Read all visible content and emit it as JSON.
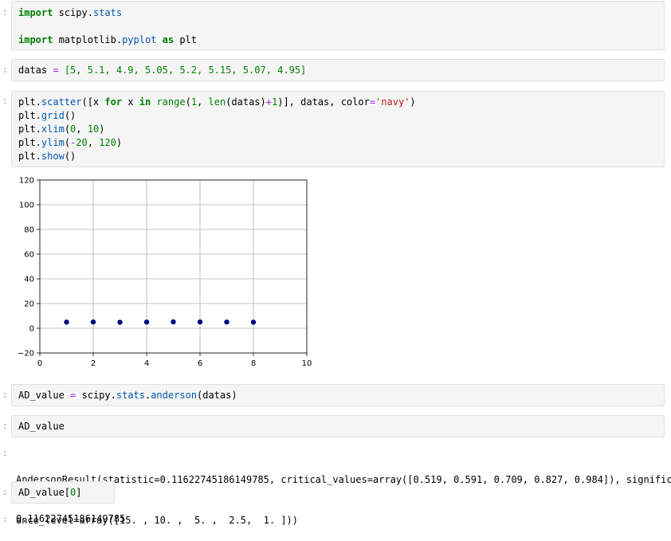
{
  "cells": [
    {
      "kind": "code",
      "lines": [
        [
          {
            "t": "kw",
            "v": "import"
          },
          {
            "t": "nm",
            "v": " scipy."
          },
          {
            "t": "fn",
            "v": "stats"
          }
        ],
        [],
        [
          {
            "t": "kw",
            "v": "import"
          },
          {
            "t": "nm",
            "v": " matplotlib."
          },
          {
            "t": "fn",
            "v": "pyplot"
          },
          {
            "t": "nm",
            "v": " "
          },
          {
            "t": "kw",
            "v": "as"
          },
          {
            "t": "nm",
            "v": " plt"
          }
        ]
      ]
    },
    {
      "kind": "code",
      "lines": [
        [
          {
            "t": "nm",
            "v": "datas "
          },
          {
            "t": "op",
            "v": "="
          },
          {
            "t": "nm",
            "v": " "
          },
          {
            "t": "num",
            "v": "[5, 5.1, 4.9, 5.05, 5.2, 5.15, 5.07, 4.95]"
          }
        ]
      ]
    },
    {
      "kind": "code",
      "lines": [
        [
          {
            "t": "nm",
            "v": "plt."
          },
          {
            "t": "fn",
            "v": "scatter"
          },
          {
            "t": "nm",
            "v": "([x "
          },
          {
            "t": "kw",
            "v": "for"
          },
          {
            "t": "nm",
            "v": " x "
          },
          {
            "t": "kw",
            "v": "in"
          },
          {
            "t": "nm",
            "v": " "
          },
          {
            "t": "num",
            "v": "range"
          },
          {
            "t": "nm",
            "v": "("
          },
          {
            "t": "num",
            "v": "1"
          },
          {
            "t": "nm",
            "v": ", "
          },
          {
            "t": "num",
            "v": "len"
          },
          {
            "t": "nm",
            "v": "(datas)"
          },
          {
            "t": "op",
            "v": "+"
          },
          {
            "t": "num",
            "v": "1"
          },
          {
            "t": "nm",
            "v": ")], datas, color"
          },
          {
            "t": "op",
            "v": "="
          },
          {
            "t": "str",
            "v": "'navy'"
          },
          {
            "t": "nm",
            "v": ")"
          }
        ],
        [
          {
            "t": "nm",
            "v": "plt."
          },
          {
            "t": "fn",
            "v": "grid"
          },
          {
            "t": "nm",
            "v": "()"
          }
        ],
        [
          {
            "t": "nm",
            "v": "plt."
          },
          {
            "t": "fn",
            "v": "xlim"
          },
          {
            "t": "nm",
            "v": "("
          },
          {
            "t": "num",
            "v": "0"
          },
          {
            "t": "nm",
            "v": ", "
          },
          {
            "t": "num",
            "v": "10"
          },
          {
            "t": "nm",
            "v": ")"
          }
        ],
        [
          {
            "t": "nm",
            "v": "plt."
          },
          {
            "t": "fn",
            "v": "ylim"
          },
          {
            "t": "nm",
            "v": "("
          },
          {
            "t": "op",
            "v": "-"
          },
          {
            "t": "num",
            "v": "20"
          },
          {
            "t": "nm",
            "v": ", "
          },
          {
            "t": "num",
            "v": "120"
          },
          {
            "t": "nm",
            "v": ")"
          }
        ],
        [
          {
            "t": "nm",
            "v": "plt."
          },
          {
            "t": "fn",
            "v": "show"
          },
          {
            "t": "nm",
            "v": "()"
          }
        ]
      ]
    },
    {
      "kind": "code",
      "lines": [
        [
          {
            "t": "nm",
            "v": "AD_value "
          },
          {
            "t": "op",
            "v": "="
          },
          {
            "t": "nm",
            "v": " scipy."
          },
          {
            "t": "fn",
            "v": "stats"
          },
          {
            "t": "nm",
            "v": "."
          },
          {
            "t": "fn",
            "v": "anderson"
          },
          {
            "t": "nm",
            "v": "(datas)"
          }
        ]
      ]
    },
    {
      "kind": "code",
      "lines": [
        [
          {
            "t": "nm",
            "v": "AD_value"
          }
        ]
      ]
    },
    {
      "kind": "code",
      "lines": [
        [
          {
            "t": "nm",
            "v": "AD_value["
          },
          {
            "t": "num",
            "v": "0"
          },
          {
            "t": "nm",
            "v": "]"
          }
        ]
      ]
    }
  ],
  "outputs": {
    "anderson_result": [
      "AndersonResult(statistic=0.11622745186149785, critical_values=array([0.519, 0.591, 0.709, 0.827, 0.984]), signific",
      "ance_level=array([15. , 10. ,  5. ,  2.5,  1. ]))"
    ],
    "ad_value_0": "0.11622745186149785"
  },
  "colors": {
    "point": "#000080",
    "grid": "#b0b0b0",
    "cell_bg": "#f5f5f5"
  },
  "chart_data": {
    "type": "scatter",
    "x": [
      1,
      2,
      3,
      4,
      5,
      6,
      7,
      8
    ],
    "y": [
      5,
      5.1,
      4.9,
      5.05,
      5.2,
      5.15,
      5.07,
      4.95
    ],
    "xlim": [
      0,
      10
    ],
    "ylim": [
      -20,
      120
    ],
    "xticks": [
      0,
      2,
      4,
      6,
      8,
      10
    ],
    "yticks": [
      -20,
      0,
      20,
      40,
      60,
      80,
      100,
      120
    ],
    "grid": true,
    "color": "navy",
    "title": "",
    "xlabel": "",
    "ylabel": ""
  }
}
